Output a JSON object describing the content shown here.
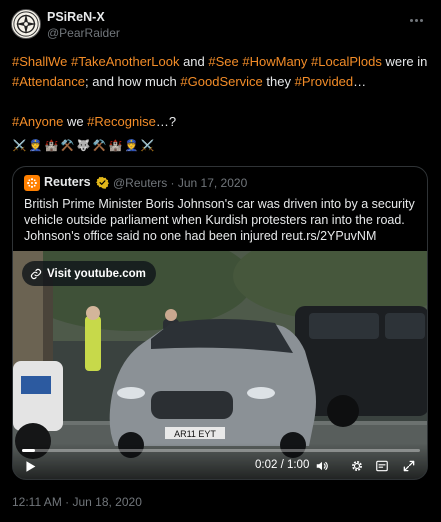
{
  "author": {
    "display_name": "PSiReN-X",
    "handle": "@PearRaider",
    "avatar_icon": "emblem-avatar-icon"
  },
  "body": {
    "line1": [
      {
        "text": "#ShallWe",
        "tag": true
      },
      {
        "text": " ",
        "tag": false
      },
      {
        "text": "#TakeAnotherLook",
        "tag": true
      },
      {
        "text": " and ",
        "tag": false
      },
      {
        "text": "#See",
        "tag": true
      },
      {
        "text": " ",
        "tag": false
      },
      {
        "text": "#HowMany",
        "tag": true
      },
      {
        "text": " ",
        "tag": false
      },
      {
        "text": "#LocalPlods",
        "tag": true
      },
      {
        "text": " were in ",
        "tag": false
      },
      {
        "text": "#Attendance",
        "tag": true
      },
      {
        "text": "; and how much ",
        "tag": false
      },
      {
        "text": "#GoodService",
        "tag": true
      },
      {
        "text": " they ",
        "tag": false
      },
      {
        "text": "#Provided",
        "tag": true
      },
      {
        "text": "…",
        "tag": false
      }
    ],
    "line2": [
      {
        "text": "#Anyone",
        "tag": true
      },
      {
        "text": " we ",
        "tag": false
      },
      {
        "text": "#Recognise",
        "tag": true
      },
      {
        "text": "…?",
        "tag": false
      }
    ],
    "emojis": [
      "⚔️",
      "👮",
      "🏰",
      "⚒️",
      "🐺",
      "⚒️",
      "🏰",
      "👮",
      "⚔️"
    ],
    "tag_color": "#f28c28"
  },
  "quote": {
    "name": "Reuters",
    "handle": "@Reuters",
    "date": "Jun 17, 2020",
    "meta": "@Reuters · Jun 17, 2020",
    "text": "British Prime Minister Boris Johnson's car was driven into by a security vehicle outside parliament when Kurdish protesters ran into the road. Johnson's office said no one had been injured reut.rs/2YPuvNM",
    "logo_color": "#ff8000",
    "verified_color": "#e2b719"
  },
  "video": {
    "visit_label": "Visit youtube.com",
    "plate": "AR11 EYT",
    "time": "0:02 / 1:00",
    "progress": 0.033
  },
  "timestamp": "12:11 AM · Jun 18, 2020"
}
